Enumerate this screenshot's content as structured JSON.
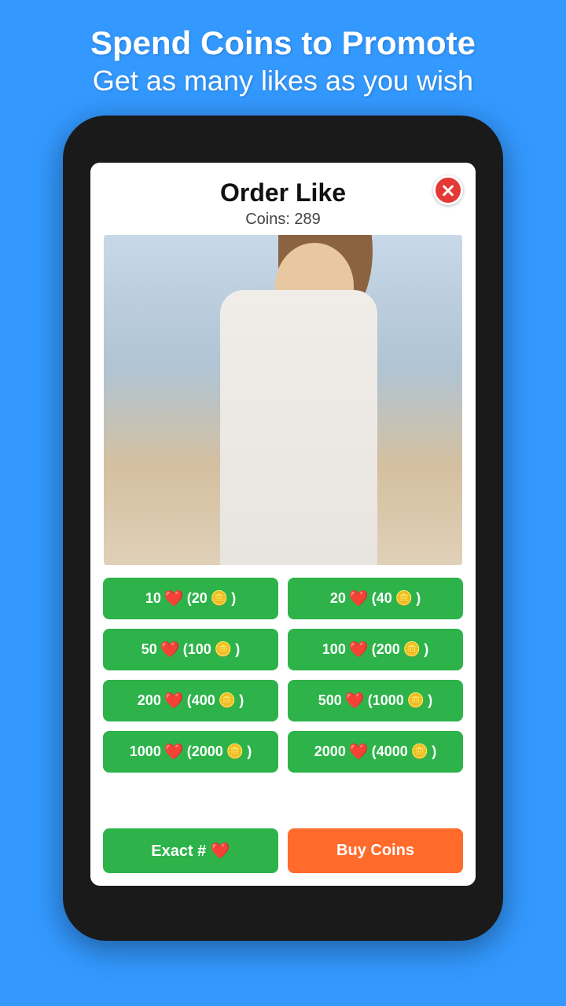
{
  "background": {
    "color": "#3399ff"
  },
  "header": {
    "line1": "Spend Coins to Promote",
    "line2": "Get as many likes as you wish"
  },
  "modal": {
    "title": "Order Like",
    "coins_label": "Coins: 289",
    "close_icon": "close-icon"
  },
  "like_options": [
    {
      "id": "opt1",
      "likes": 10,
      "coins": 20,
      "label": "10 ❤️ (20 🪙)"
    },
    {
      "id": "opt2",
      "likes": 20,
      "coins": 40,
      "label": "20 ❤️ (40 🪙)"
    },
    {
      "id": "opt3",
      "likes": 50,
      "coins": 100,
      "label": "50 ❤️ (100 🪙)"
    },
    {
      "id": "opt4",
      "likes": 100,
      "coins": 200,
      "label": "100 ❤️ (200 🪙)"
    },
    {
      "id": "opt5",
      "likes": 200,
      "coins": 400,
      "label": "200 ❤️ (400 🪙)"
    },
    {
      "id": "opt6",
      "likes": 500,
      "coins": 1000,
      "label": "500 ❤️ (1000 🪙)"
    },
    {
      "id": "opt7",
      "likes": 1000,
      "coins": 2000,
      "label": "1000 ❤️ (2000 🪙)"
    },
    {
      "id": "opt8",
      "likes": 2000,
      "coins": 4000,
      "label": "2000 ❤️ (4000 🪙)"
    }
  ],
  "bottom_buttons": {
    "exact_label": "Exact  # ❤️",
    "buy_label": "Buy Coins"
  }
}
